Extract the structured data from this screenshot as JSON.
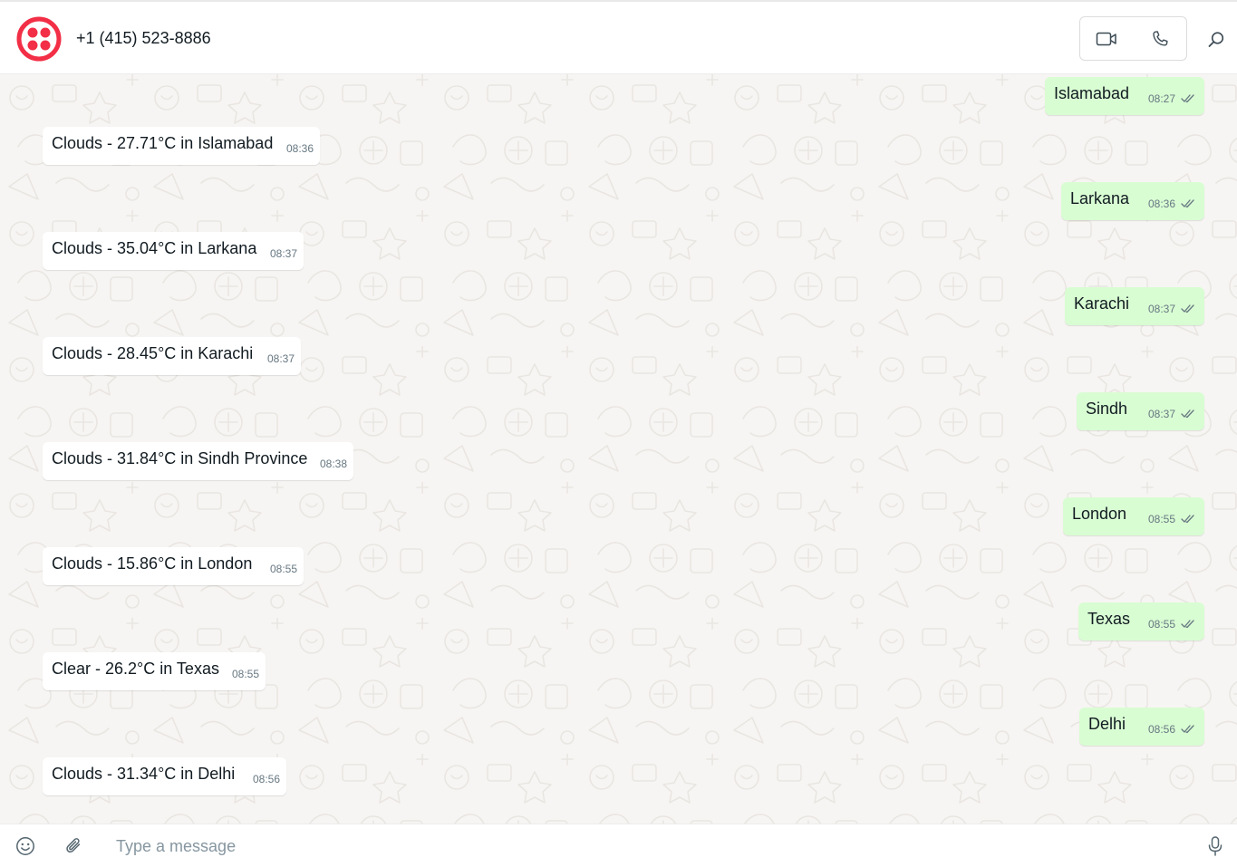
{
  "header": {
    "contact_name": "+1 (415) 523-8886",
    "logo_icon": "twilio-logo-icon",
    "video_icon": "video-camera-icon",
    "phone_icon": "phone-icon",
    "search_icon": "search-icon"
  },
  "colors": {
    "brand": "#f22f46",
    "outgoing_bubble": "#d9fdd3",
    "incoming_bubble": "#ffffff",
    "chat_background": "#f7f5f3",
    "time_text": "#667781"
  },
  "messages": [
    {
      "direction": "out",
      "text": "Islamabad",
      "time": "08:27",
      "status": "read"
    },
    {
      "direction": "in",
      "text": "Clouds - 27.71°C in Islamabad",
      "time": "08:36"
    },
    {
      "direction": "out",
      "text": "Larkana",
      "time": "08:36",
      "status": "read"
    },
    {
      "direction": "in",
      "text": "Clouds - 35.04°C in Larkana",
      "time": "08:37"
    },
    {
      "direction": "out",
      "text": "Karachi",
      "time": "08:37",
      "status": "read"
    },
    {
      "direction": "in",
      "text": "Clouds - 28.45°C in Karachi",
      "time": "08:37"
    },
    {
      "direction": "out",
      "text": "Sindh",
      "time": "08:37",
      "status": "read"
    },
    {
      "direction": "in",
      "text": "Clouds - 31.84°C in Sindh Province",
      "time": "08:38"
    },
    {
      "direction": "out",
      "text": "London",
      "time": "08:55",
      "status": "read"
    },
    {
      "direction": "in",
      "text": "Clouds - 15.86°C in London",
      "time": "08:55"
    },
    {
      "direction": "out",
      "text": "Texas",
      "time": "08:55",
      "status": "read"
    },
    {
      "direction": "in",
      "text": "Clear - 26.2°C in Texas",
      "time": "08:55"
    },
    {
      "direction": "out",
      "text": "Delhi",
      "time": "08:56",
      "status": "read"
    },
    {
      "direction": "in",
      "text": "Clouds - 31.34°C in Delhi",
      "time": "08:56"
    }
  ],
  "composer": {
    "placeholder": "Type a message",
    "value": "",
    "emoji_icon": "emoji-icon",
    "attach_icon": "paperclip-icon",
    "mic_icon": "microphone-icon"
  }
}
